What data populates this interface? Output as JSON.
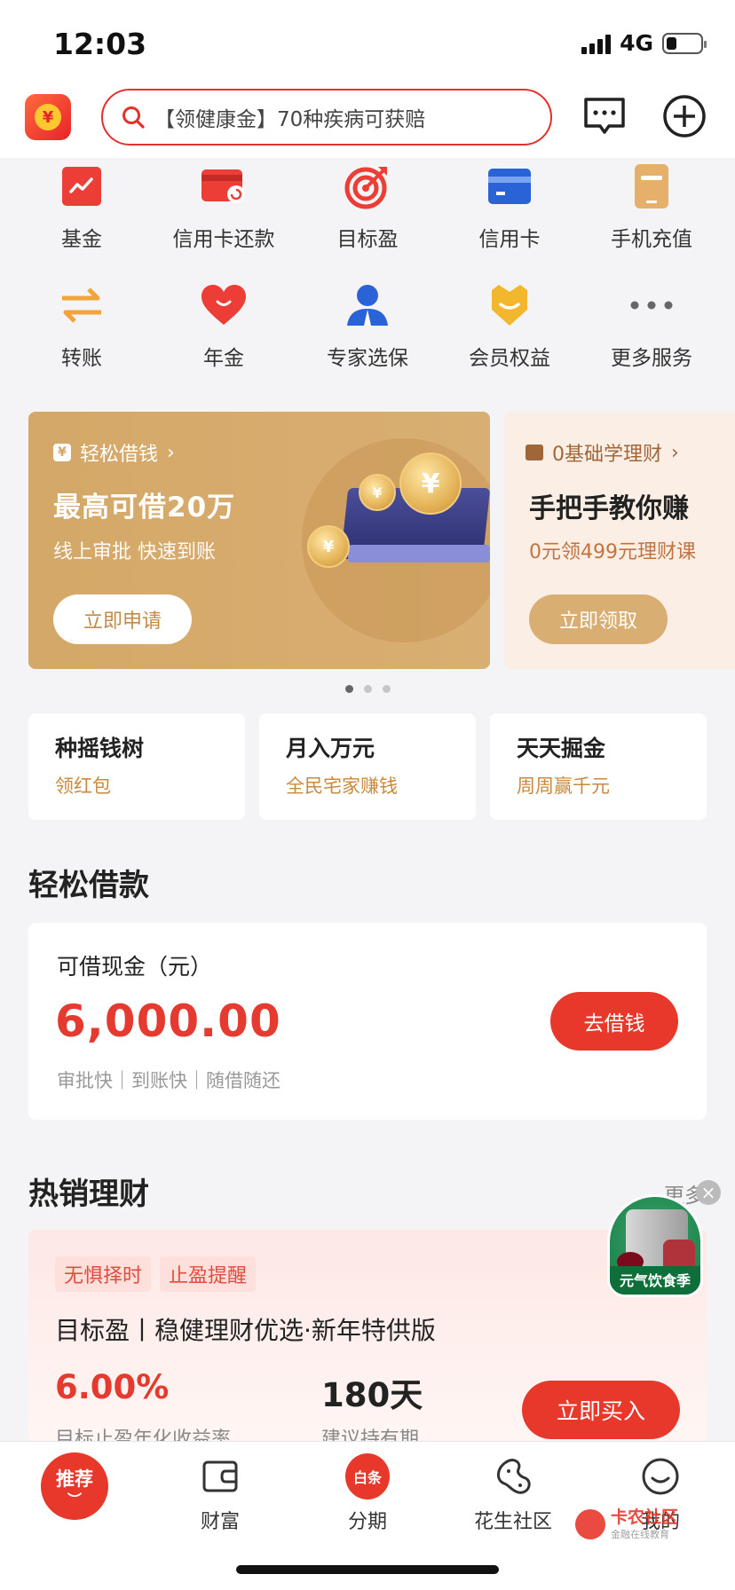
{
  "status_bar": {
    "time": "12:03",
    "network": "4G",
    "battery_level": 0.3
  },
  "header": {
    "search_placeholder": "【领健康金】70种疾病可获赔",
    "icons": [
      "app-logo-icon",
      "search-icon",
      "message-icon",
      "add-circle-icon"
    ]
  },
  "quick_grid": [
    {
      "label": "基金",
      "icon": "fund-chart-icon"
    },
    {
      "label": "信用卡还款",
      "icon": "card-repay-icon"
    },
    {
      "label": "目标盈",
      "icon": "target-icon"
    },
    {
      "label": "信用卡",
      "icon": "credit-card-icon"
    },
    {
      "label": "手机充值",
      "icon": "phone-topup-icon"
    },
    {
      "label": "转账",
      "icon": "transfer-arrows-icon"
    },
    {
      "label": "年金",
      "icon": "heart-icon"
    },
    {
      "label": "专家选保",
      "icon": "expert-person-icon"
    },
    {
      "label": "会员权益",
      "icon": "member-badge-icon"
    },
    {
      "label": "更多服务",
      "icon": "more-dots-icon"
    }
  ],
  "banners": [
    {
      "tag": "轻松借钱",
      "title": "最高可借20万",
      "subtitle": "线上审批 快速到账",
      "button": "立即申请"
    },
    {
      "tag": "0基础学理财",
      "title": "手把手教你赚",
      "subtitle": "0元领499元理财课",
      "button": "立即领取"
    }
  ],
  "carousel": {
    "count": 3,
    "active": 0
  },
  "promos": [
    {
      "title": "种摇钱树",
      "subtitle": "领红包"
    },
    {
      "title": "月入万元",
      "subtitle": "全民宅家赚钱"
    },
    {
      "title": "天天掘金",
      "subtitle": "周周赢千元"
    }
  ],
  "loan_section": {
    "title": "轻松借款",
    "label": "可借现金（元）",
    "amount": "6,000.00",
    "note": "审批快｜到账快｜随借随还",
    "button": "去借钱"
  },
  "finance_section": {
    "title": "热销理财",
    "more": "更多",
    "product": {
      "tags": [
        "无惧择时",
        "止盈提醒"
      ],
      "name": "目标盈丨稳健理财优选·新年特供版",
      "rate": "6.00%",
      "rate_label": "目标止盈年化收益率",
      "days": "180天",
      "days_label": "建议持有期",
      "button": "立即买入"
    }
  },
  "floating_ad": {
    "label": "元气饮食季",
    "close": "×"
  },
  "tabbar": [
    {
      "label": "推荐",
      "icon": "recommend-icon",
      "active": true
    },
    {
      "label": "财富",
      "icon": "wallet-icon"
    },
    {
      "label": "分期",
      "icon": "baitiao-icon",
      "badge": "白条"
    },
    {
      "label": "花生社区",
      "icon": "peanut-icon"
    },
    {
      "label": "我的",
      "icon": "profile-icon"
    }
  ],
  "watermark": {
    "title": "卡农社区",
    "subtitle": "金融在线教育"
  },
  "colors": {
    "brand_red": "#e8372b",
    "gold": "#d4a867",
    "background": "#f4f4f6"
  }
}
